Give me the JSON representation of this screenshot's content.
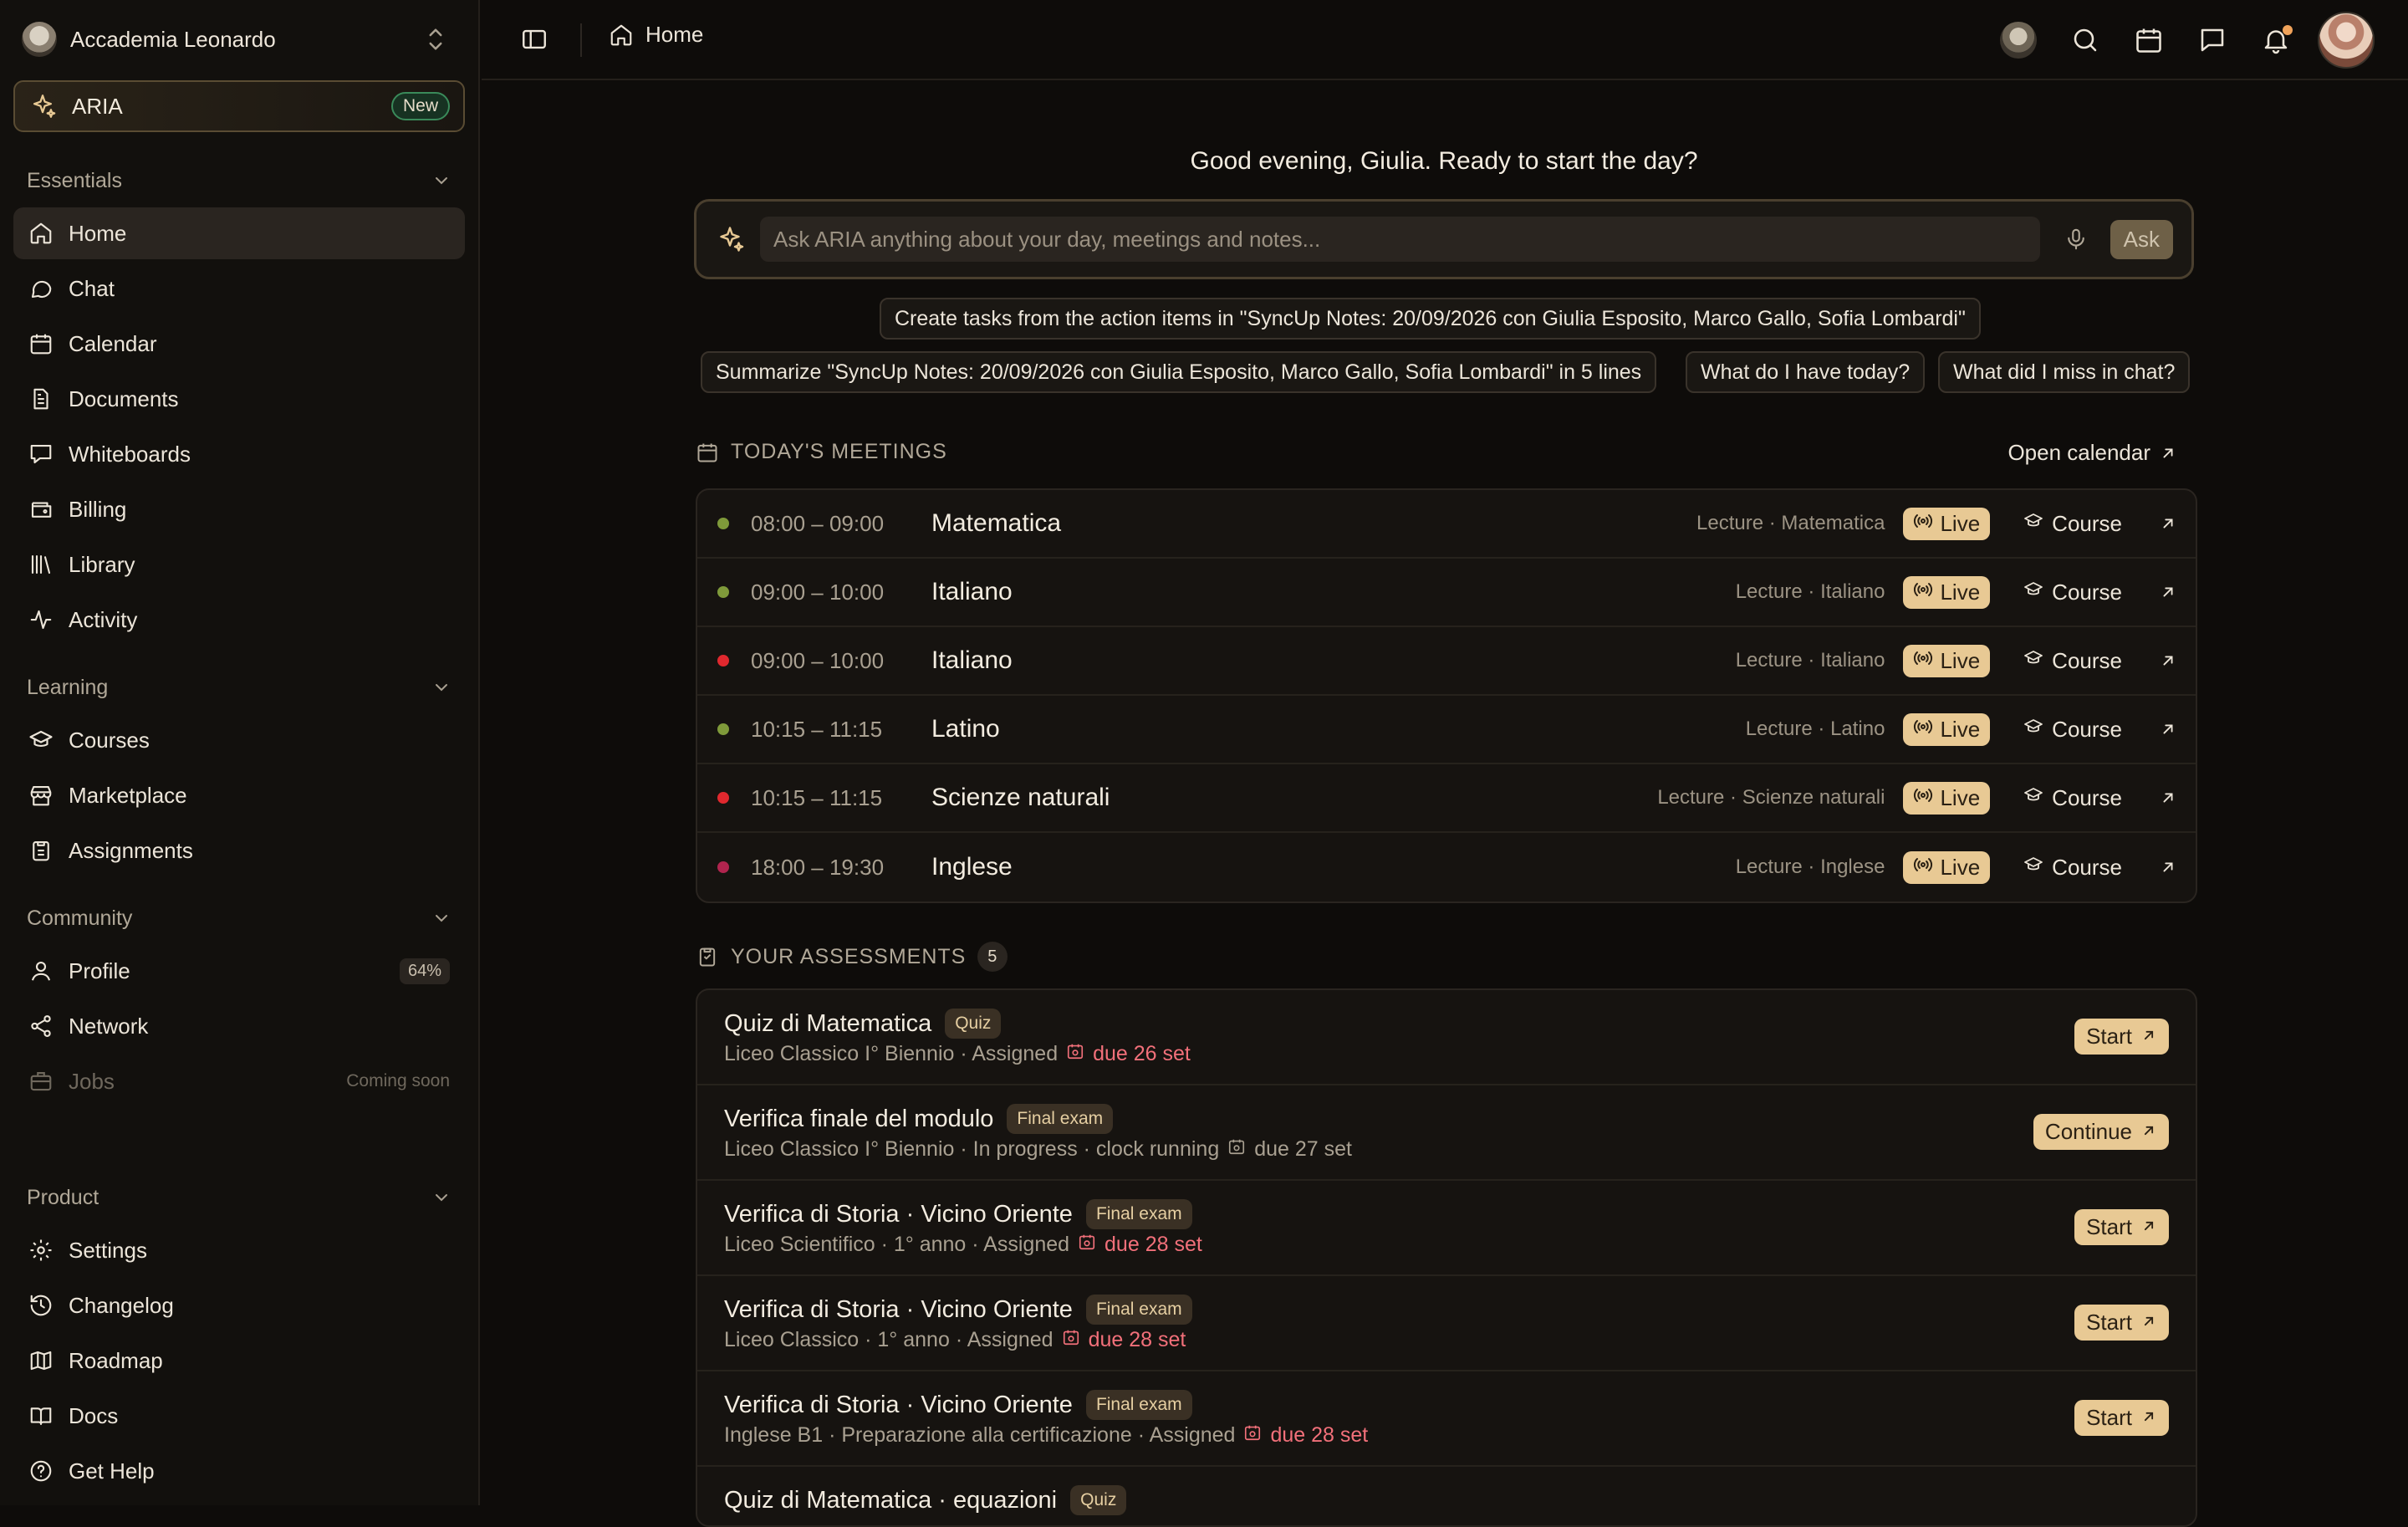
{
  "workspace": {
    "name": "Accademia Leonardo"
  },
  "aria": {
    "label": "ARIA",
    "badge": "New"
  },
  "sidebar": {
    "sections": [
      {
        "title": "Essentials"
      },
      {
        "title": "Learning"
      },
      {
        "title": "Community"
      },
      {
        "title": "Product"
      }
    ],
    "essentials": [
      "Home",
      "Chat",
      "Calendar",
      "Documents",
      "Whiteboards",
      "Billing",
      "Library",
      "Activity"
    ],
    "learning": [
      "Courses",
      "Marketplace",
      "Assignments"
    ],
    "community": {
      "profile": "Profile",
      "profile_pct": "64%",
      "network": "Network",
      "jobs": "Jobs",
      "jobs_note": "Coming soon"
    },
    "product": [
      "Settings",
      "Changelog",
      "Roadmap",
      "Docs",
      "Get Help"
    ]
  },
  "topbar": {
    "breadcrumb": "Home"
  },
  "main": {
    "greeting": "Good evening, Giulia. Ready to start the day?",
    "ask_placeholder": "Ask ARIA anything about your day, meetings and notes...",
    "ask_button": "Ask",
    "suggestions": [
      "Create tasks from the action items in \"SyncUp Notes: 20/09/2026 con Giulia Esposito, Marco Gallo, Sofia Lombardi\"",
      "Summarize \"SyncUp Notes: 20/09/2026 con Giulia Esposito, Marco Gallo, Sofia Lombardi\" in 5 lines",
      "What do I have today?",
      "What did I miss in chat?"
    ],
    "meetings_title": "TODAY'S MEETINGS",
    "open_calendar": "Open calendar",
    "live_label": "Live",
    "course_label": "Course",
    "meetings": [
      {
        "time": "08:00 – 09:00",
        "title": "Matematica",
        "meta": "Lecture · Matematica",
        "dot": "#7f9a3a"
      },
      {
        "time": "09:00 – 10:00",
        "title": "Italiano",
        "meta": "Lecture · Italiano",
        "dot": "#7f9a3a"
      },
      {
        "time": "09:00 – 10:00",
        "title": "Italiano",
        "meta": "Lecture · Italiano",
        "dot": "#e0282e"
      },
      {
        "time": "10:15 – 11:15",
        "title": "Latino",
        "meta": "Lecture · Latino",
        "dot": "#7f9a3a"
      },
      {
        "time": "10:15 – 11:15",
        "title": "Scienze naturali",
        "meta": "Lecture · Scienze naturali",
        "dot": "#e0282e"
      },
      {
        "time": "18:00 – 19:30",
        "title": "Inglese",
        "meta": "Lecture · Inglese",
        "dot": "#b0244e"
      }
    ],
    "assessments_title": "YOUR ASSESSMENTS",
    "assessments_count": "5",
    "assessments": [
      {
        "title": "Quiz di Matematica",
        "tag": "Quiz",
        "sub": "Liceo Classico I° Biennio",
        "status": " · Assigned",
        "due": "due 26 set",
        "due_red": true,
        "action": "Start"
      },
      {
        "title": "Verifica finale del modulo",
        "tag": "Final exam",
        "sub": "Liceo Classico I° Biennio",
        "status": " · In progress · clock running",
        "due": "due 27 set",
        "due_red": false,
        "action": "Continue"
      },
      {
        "title": "Verifica di Storia · Vicino Oriente",
        "tag": "Final exam",
        "sub": "Liceo Scientifico · 1° anno",
        "status": " · Assigned",
        "due": "due 28 set",
        "due_red": true,
        "action": "Start"
      },
      {
        "title": "Verifica di Storia · Vicino Oriente",
        "tag": "Final exam",
        "sub": "Liceo Classico · 1° anno",
        "status": " · Assigned",
        "due": "due 28 set",
        "due_red": true,
        "action": "Start"
      },
      {
        "title": "Verifica di Storia · Vicino Oriente",
        "tag": "Final exam",
        "sub": "Inglese B1 · Preparazione alla certificazione",
        "status": " · Assigned",
        "due": "due 28 set",
        "due_red": true,
        "action": "Start"
      },
      {
        "title": "Quiz di Matematica · equazioni",
        "tag": "Quiz",
        "sub": "",
        "status": "",
        "due": "",
        "due_red": false,
        "action": ""
      }
    ]
  },
  "icons": {
    "sidebar": [
      "home-icon",
      "chat-icon",
      "calendar-icon",
      "document-icon",
      "whiteboard-icon",
      "wallet-icon",
      "library-icon",
      "activity-icon",
      "graduation-cap-icon",
      "store-icon",
      "clipboard-icon",
      "user-icon",
      "share-icon",
      "briefcase-icon",
      "gear-icon",
      "history-icon",
      "map-icon",
      "book-icon",
      "help-icon"
    ],
    "topbar": [
      "sidebar-toggle-icon",
      "home-icon",
      "search-icon",
      "calendar-icon",
      "message-icon",
      "bell-icon"
    ]
  },
  "colors": {
    "accent": "#e8c994",
    "background": "#0e0c0a",
    "due_red": "#f2707a",
    "new_badge": "#3a8a5a"
  }
}
